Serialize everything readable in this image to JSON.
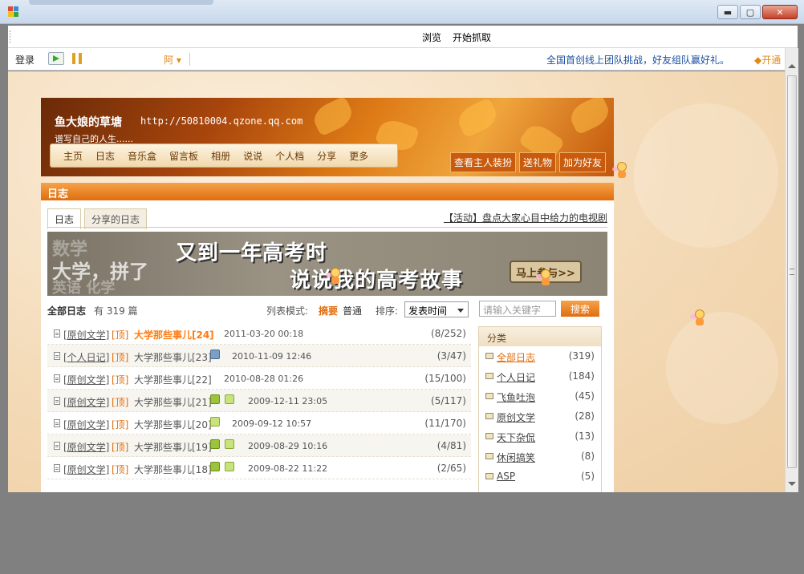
{
  "window": {
    "controls": {
      "minimize": "▬",
      "maximize": "▢",
      "close": "✕"
    }
  },
  "menubar": {
    "items": [
      "浏览",
      "开始抓取"
    ]
  },
  "toolbar": {
    "login": "登录",
    "font_label": "阿 ▾",
    "promo": "全国首创线上团队挑战，好友组队赢好礼。",
    "open_vip": "开通"
  },
  "banner": {
    "site_name": "鱼大娘的草塘",
    "url": "http://50810004.qzone.qq.com",
    "motto": "谱写自己的人生......",
    "nav": [
      "主页",
      "日志",
      "音乐盒",
      "留言板",
      "相册",
      "说说",
      "个人档",
      "分享",
      "更多"
    ],
    "buttons": [
      "查看主人装扮",
      "送礼物",
      "加为好友"
    ]
  },
  "panel": {
    "heading": "日志",
    "tabs": [
      "日志",
      "分享的日志"
    ],
    "activity_link": "【活动】盘点大家心目中给力的电视剧",
    "ad": {
      "line1": "又到一年高考时",
      "line2": "说说我的高考故事",
      "button": "马上参与>>",
      "side1": "数学",
      "side2": "大学，拼了",
      "side3": "英语 化学"
    },
    "list_head": {
      "title": "全部日志",
      "count": "有 319 篇",
      "mode_label": "列表模式:",
      "mode_summary": "摘要",
      "mode_normal": "普通",
      "sort_label": "排序:",
      "sort_value": "发表时间"
    },
    "search": {
      "placeholder": "请输入关键字",
      "button": "搜索"
    },
    "rows": [
      {
        "cat": "[原创文学]",
        "top": "[顶]",
        "title": "大学那些事儿[24]",
        "date": "2011-03-20 00:18",
        "stat": "(8/252)",
        "hot": true,
        "badges": []
      },
      {
        "cat": "[个人日记]",
        "top": "[顶]",
        "title": "大学那些事儿[23]",
        "date": "2010-11-09 12:46",
        "stat": "(3/47)",
        "hot": false,
        "badges": [
          "pic"
        ]
      },
      {
        "cat": "[原创文学]",
        "top": "[顶]",
        "title": "大学那些事儿[22]",
        "date": "2010-08-28 01:26",
        "stat": "(15/100)",
        "hot": false,
        "badges": []
      },
      {
        "cat": "[原创文学]",
        "top": "[顶]",
        "title": "大学那些事儿[21]",
        "date": "2009-12-11 23:05",
        "stat": "(5/117)",
        "hot": false,
        "badges": [
          "money",
          "note"
        ]
      },
      {
        "cat": "[原创文学]",
        "top": "[顶]",
        "title": "大学那些事儿[20]",
        "date": "2009-09-12 10:57",
        "stat": "(11/170)",
        "hot": false,
        "badges": [
          "note"
        ]
      },
      {
        "cat": "[原创文学]",
        "top": "[顶]",
        "title": "大学那些事儿[19]",
        "date": "2009-08-29 10:16",
        "stat": "(4/81)",
        "hot": false,
        "badges": [
          "money",
          "note"
        ]
      },
      {
        "cat": "[原创文学]",
        "top": "[顶]",
        "title": "大学那些事儿[18]",
        "date": "2009-08-22 11:22",
        "stat": "(2/65)",
        "hot": false,
        "badges": [
          "money",
          "note"
        ]
      }
    ],
    "sidebar": {
      "heading": "分类",
      "items": [
        {
          "label": "全部日志",
          "count": "(319)",
          "active": true
        },
        {
          "label": "个人日记",
          "count": "(184)",
          "active": false
        },
        {
          "label": "飞鱼吐泡",
          "count": "(45)",
          "active": false
        },
        {
          "label": "原创文学",
          "count": "(28)",
          "active": false
        },
        {
          "label": "天下杂侃",
          "count": "(13)",
          "active": false
        },
        {
          "label": "休闲搞笑",
          "count": "(8)",
          "active": false
        },
        {
          "label": "ASP",
          "count": "(5)",
          "active": false
        }
      ]
    }
  }
}
